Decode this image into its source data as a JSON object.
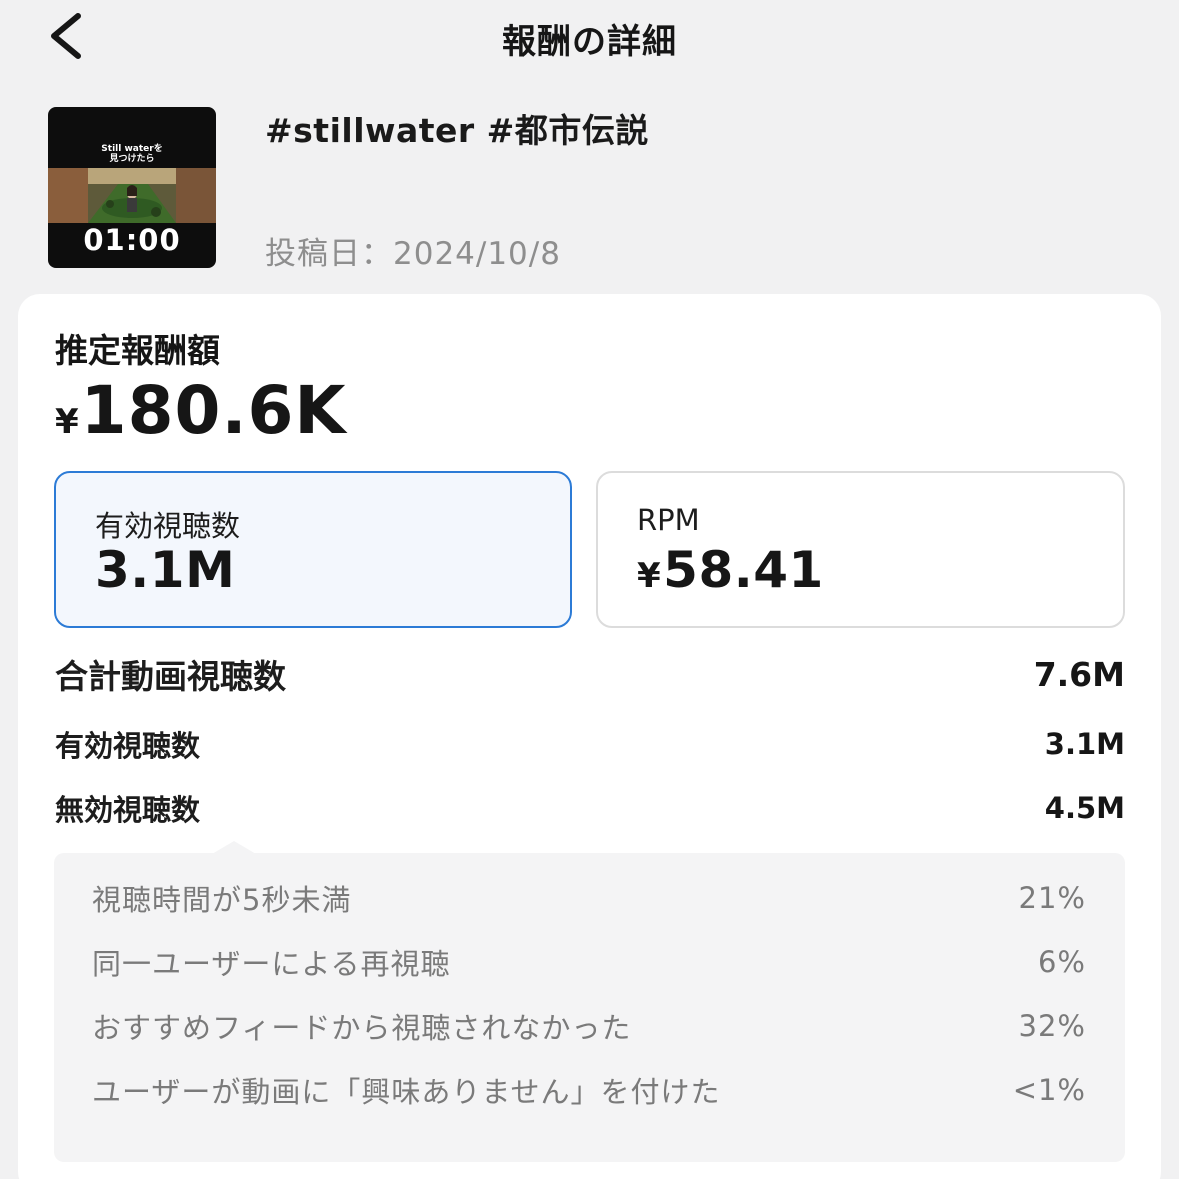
{
  "header": {
    "title": "報酬の詳細",
    "back_icon": "chevron-left-icon"
  },
  "video": {
    "thumbnail_caption_line1": "Still waterを",
    "thumbnail_caption_line2": "見つけたら",
    "duration": "01:00",
    "title": "#stillwater #都市伝説",
    "post_date": "投稿日：2024/10/8"
  },
  "earnings": {
    "label": "推定報酬額",
    "currency": "¥",
    "value": "180.6K"
  },
  "metrics": [
    {
      "label": "有効視聴数",
      "currency": "",
      "value": "3.1M",
      "selected": true
    },
    {
      "label": "RPM",
      "currency": "¥",
      "value": "58.41",
      "selected": false
    }
  ],
  "views": {
    "total_label": "合計動画視聴数",
    "total_value": "7.6M",
    "qualified_label": "有効視聴数",
    "qualified_value": "3.1M",
    "unqualified_label": "無効視聴数",
    "unqualified_value": "4.5M"
  },
  "breakdown": [
    {
      "label": "視聴時間が5秒未満",
      "value": "21%"
    },
    {
      "label": "同一ユーザーによる再視聴",
      "value": "6%"
    },
    {
      "label": "おすすめフィードから視聴されなかった",
      "value": "32%"
    },
    {
      "label": "ユーザーが動画に「興味ありません」を付けた",
      "value": "<1%"
    }
  ],
  "colors": {
    "background": "#f1f1f2",
    "card": "#ffffff",
    "selected_border": "#2c7bd6",
    "selected_fill": "#f3f7fd",
    "muted_text": "#7a7a7a"
  }
}
